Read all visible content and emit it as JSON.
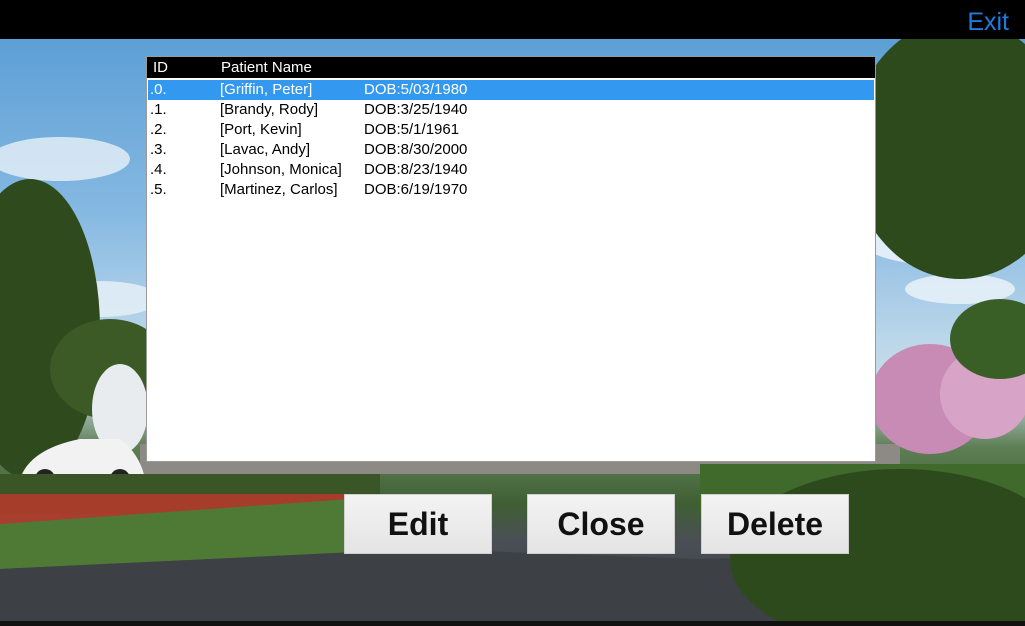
{
  "topbar": {
    "exit_label": "Exit"
  },
  "list": {
    "headers": {
      "id": "ID",
      "name": "Patient Name"
    },
    "rows": [
      {
        "id": ".0.",
        "name": "[Griffin, Peter]",
        "dob": "DOB:5/03/1980",
        "selected": true
      },
      {
        "id": ".1.",
        "name": "[Brandy, Rody]",
        "dob": "DOB:3/25/1940",
        "selected": false
      },
      {
        "id": ".2.",
        "name": "[Port, Kevin]",
        "dob": "DOB:5/1/1961",
        "selected": false
      },
      {
        "id": ".3.",
        "name": "[Lavac, Andy]",
        "dob": "DOB:8/30/2000",
        "selected": false
      },
      {
        "id": ".4.",
        "name": "[Johnson, Monica]",
        "dob": "DOB:8/23/1940",
        "selected": false
      },
      {
        "id": ".5.",
        "name": "[Martinez, Carlos]",
        "dob": "DOB:6/19/1970",
        "selected": false
      }
    ]
  },
  "buttons": {
    "edit": "Edit",
    "close": "Close",
    "delete": "Delete"
  },
  "colors": {
    "accent": "#1e7be0",
    "selection": "#3399f0",
    "header_bg": "#000000"
  }
}
